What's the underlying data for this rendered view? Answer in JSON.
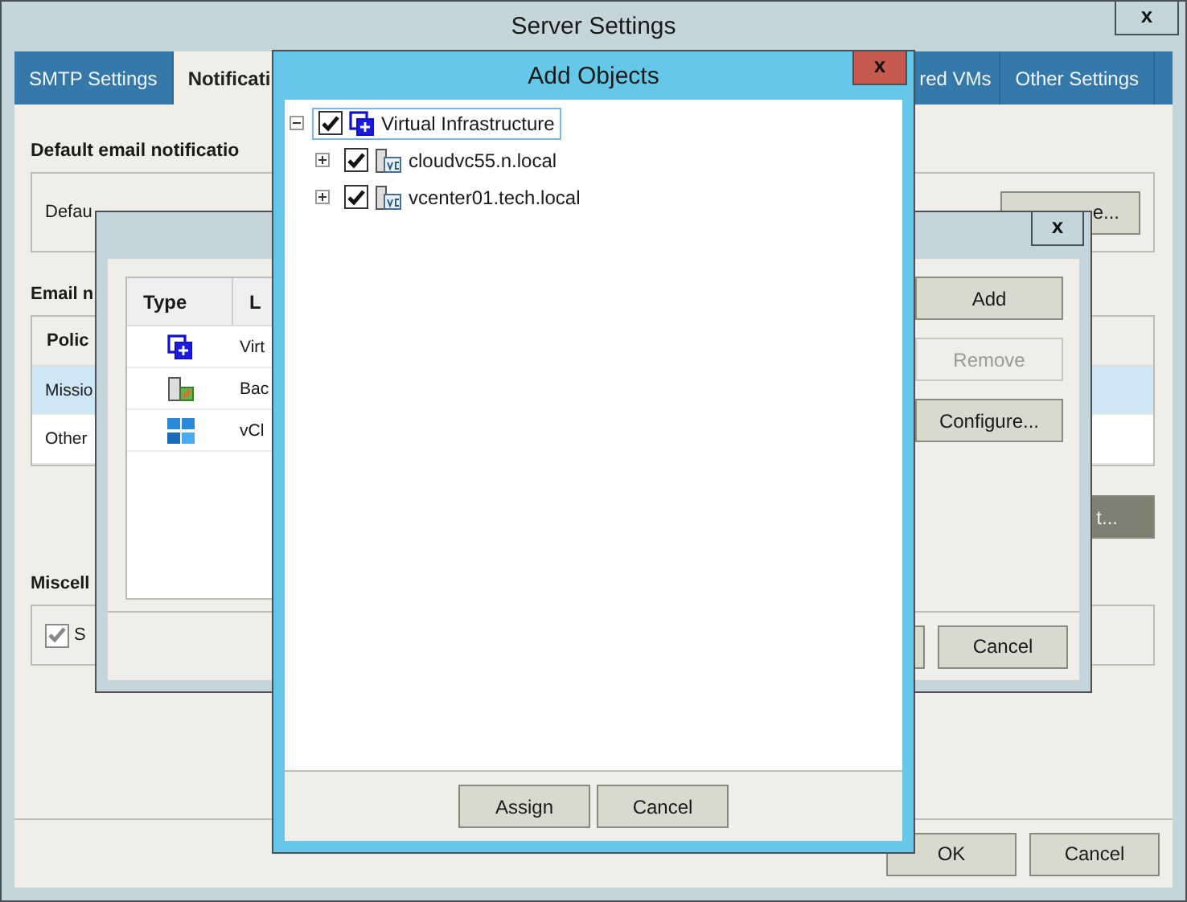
{
  "main_window": {
    "title": "Server Settings",
    "close": "x",
    "tabs": [
      {
        "label": "SMTP Settings",
        "selected": false
      },
      {
        "label": "Notificati",
        "selected": true
      },
      {
        "label": "red VMs",
        "selected": false
      },
      {
        "label": "Other Settings",
        "selected": false
      }
    ],
    "default_section": {
      "heading": "Default email notificatio",
      "text": "Defau",
      "button": "e..."
    },
    "email_section": {
      "heading": "Email n",
      "column_1": "Polic",
      "rows": [
        {
          "cell": "Missio",
          "selected": true
        },
        {
          "cell": "Other",
          "selected": false
        }
      ],
      "button": "t..."
    },
    "misc_section": {
      "heading": "Miscell",
      "checkbox": {
        "label": "S",
        "checked": true,
        "disabled": true
      }
    },
    "buttons": [
      "OK",
      "Cancel"
    ]
  },
  "objects_dialog": {
    "close": "x",
    "columns": [
      "Type",
      "L"
    ],
    "rows": [
      {
        "kind": "infrastructure",
        "cell": "Virt"
      },
      {
        "kind": "backup",
        "cell": "Bac"
      },
      {
        "kind": "cloud",
        "cell": "vCl"
      }
    ],
    "side_buttons": [
      {
        "label": "Add",
        "disabled": false
      },
      {
        "label": "Remove",
        "disabled": true
      },
      {
        "label": "Configure...",
        "disabled": false
      }
    ],
    "bottom_buttons": [
      "Cancel"
    ]
  },
  "add_objects": {
    "title": "Add Objects",
    "close": "x",
    "tree": [
      {
        "label": "Virtual Infrastructure",
        "kind": "infrastructure",
        "checked": true,
        "expanded": true,
        "focused": true,
        "children": [
          {
            "label": "cloudvc55.n.local",
            "kind": "vcenter",
            "checked": true,
            "expanded": false,
            "focused": false
          },
          {
            "label": "vcenter01.tech.local",
            "kind": "vcenter",
            "checked": true,
            "expanded": false,
            "focused": false
          }
        ]
      }
    ],
    "buttons": [
      "Assign",
      "Cancel"
    ]
  }
}
